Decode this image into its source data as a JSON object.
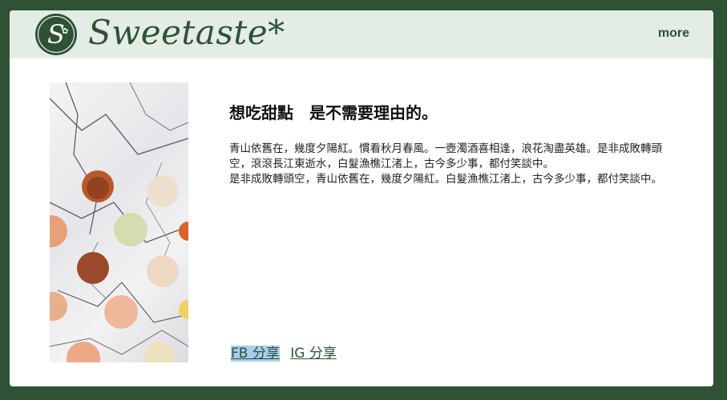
{
  "header": {
    "logo_letter": "S",
    "brand_name": "Sweetaste*",
    "more_label": "more"
  },
  "content": {
    "title": "想吃甜點　是不需要理由的。",
    "paragraphs": [
      "青山依舊在，幾度夕陽紅。慣看秋月春風。一壺濁酒喜相逢，浪花淘盡英雄。是非成敗轉頭空，滾滾長江東逝水，白髮漁樵江渚上，古今多少事，都付笑談中。",
      "是非成敗轉頭空，青山依舊在，幾度夕陽紅。白髮漁樵江渚上，古今多少事，都付笑談中。"
    ],
    "share_fb": "FB 分享",
    "share_ig": "IG 分享"
  },
  "colors": {
    "frame": "#2f5234",
    "header_bg": "#e4ece6",
    "accent": "#2f5234",
    "fb_highlight": "#a8cdf0"
  }
}
